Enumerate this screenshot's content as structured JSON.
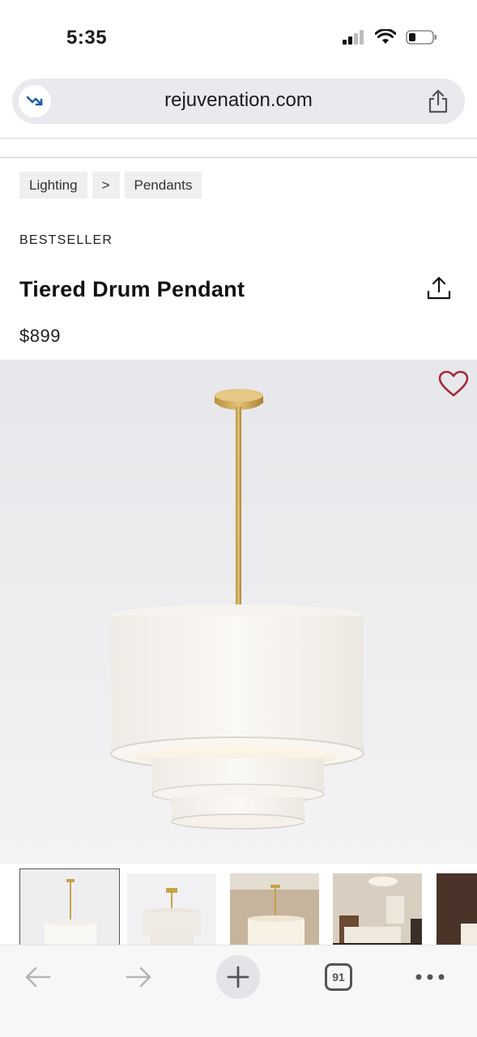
{
  "status_bar": {
    "time": "5:35",
    "icons": [
      "cellular-signal-icon",
      "wifi-icon",
      "battery-icon"
    ]
  },
  "browser": {
    "url": "rejuvenation.com",
    "left_icon": "trending-down-arrow-icon",
    "share_icon": "share-icon",
    "tab_count": "91"
  },
  "breadcrumb": [
    "Lighting",
    ">",
    "Pendants"
  ],
  "product": {
    "badge": "BESTSELLER",
    "title": "Tiered Drum Pendant",
    "price": "$899"
  },
  "colors": {
    "heart": "#a3283a",
    "brass": "#c9a24a",
    "shade": "#f7f4ee"
  },
  "toolbar": {
    "icons": [
      "back-arrow-icon",
      "forward-arrow-icon",
      "new-tab-plus-icon",
      "tabs-icon",
      "more-icon"
    ]
  }
}
